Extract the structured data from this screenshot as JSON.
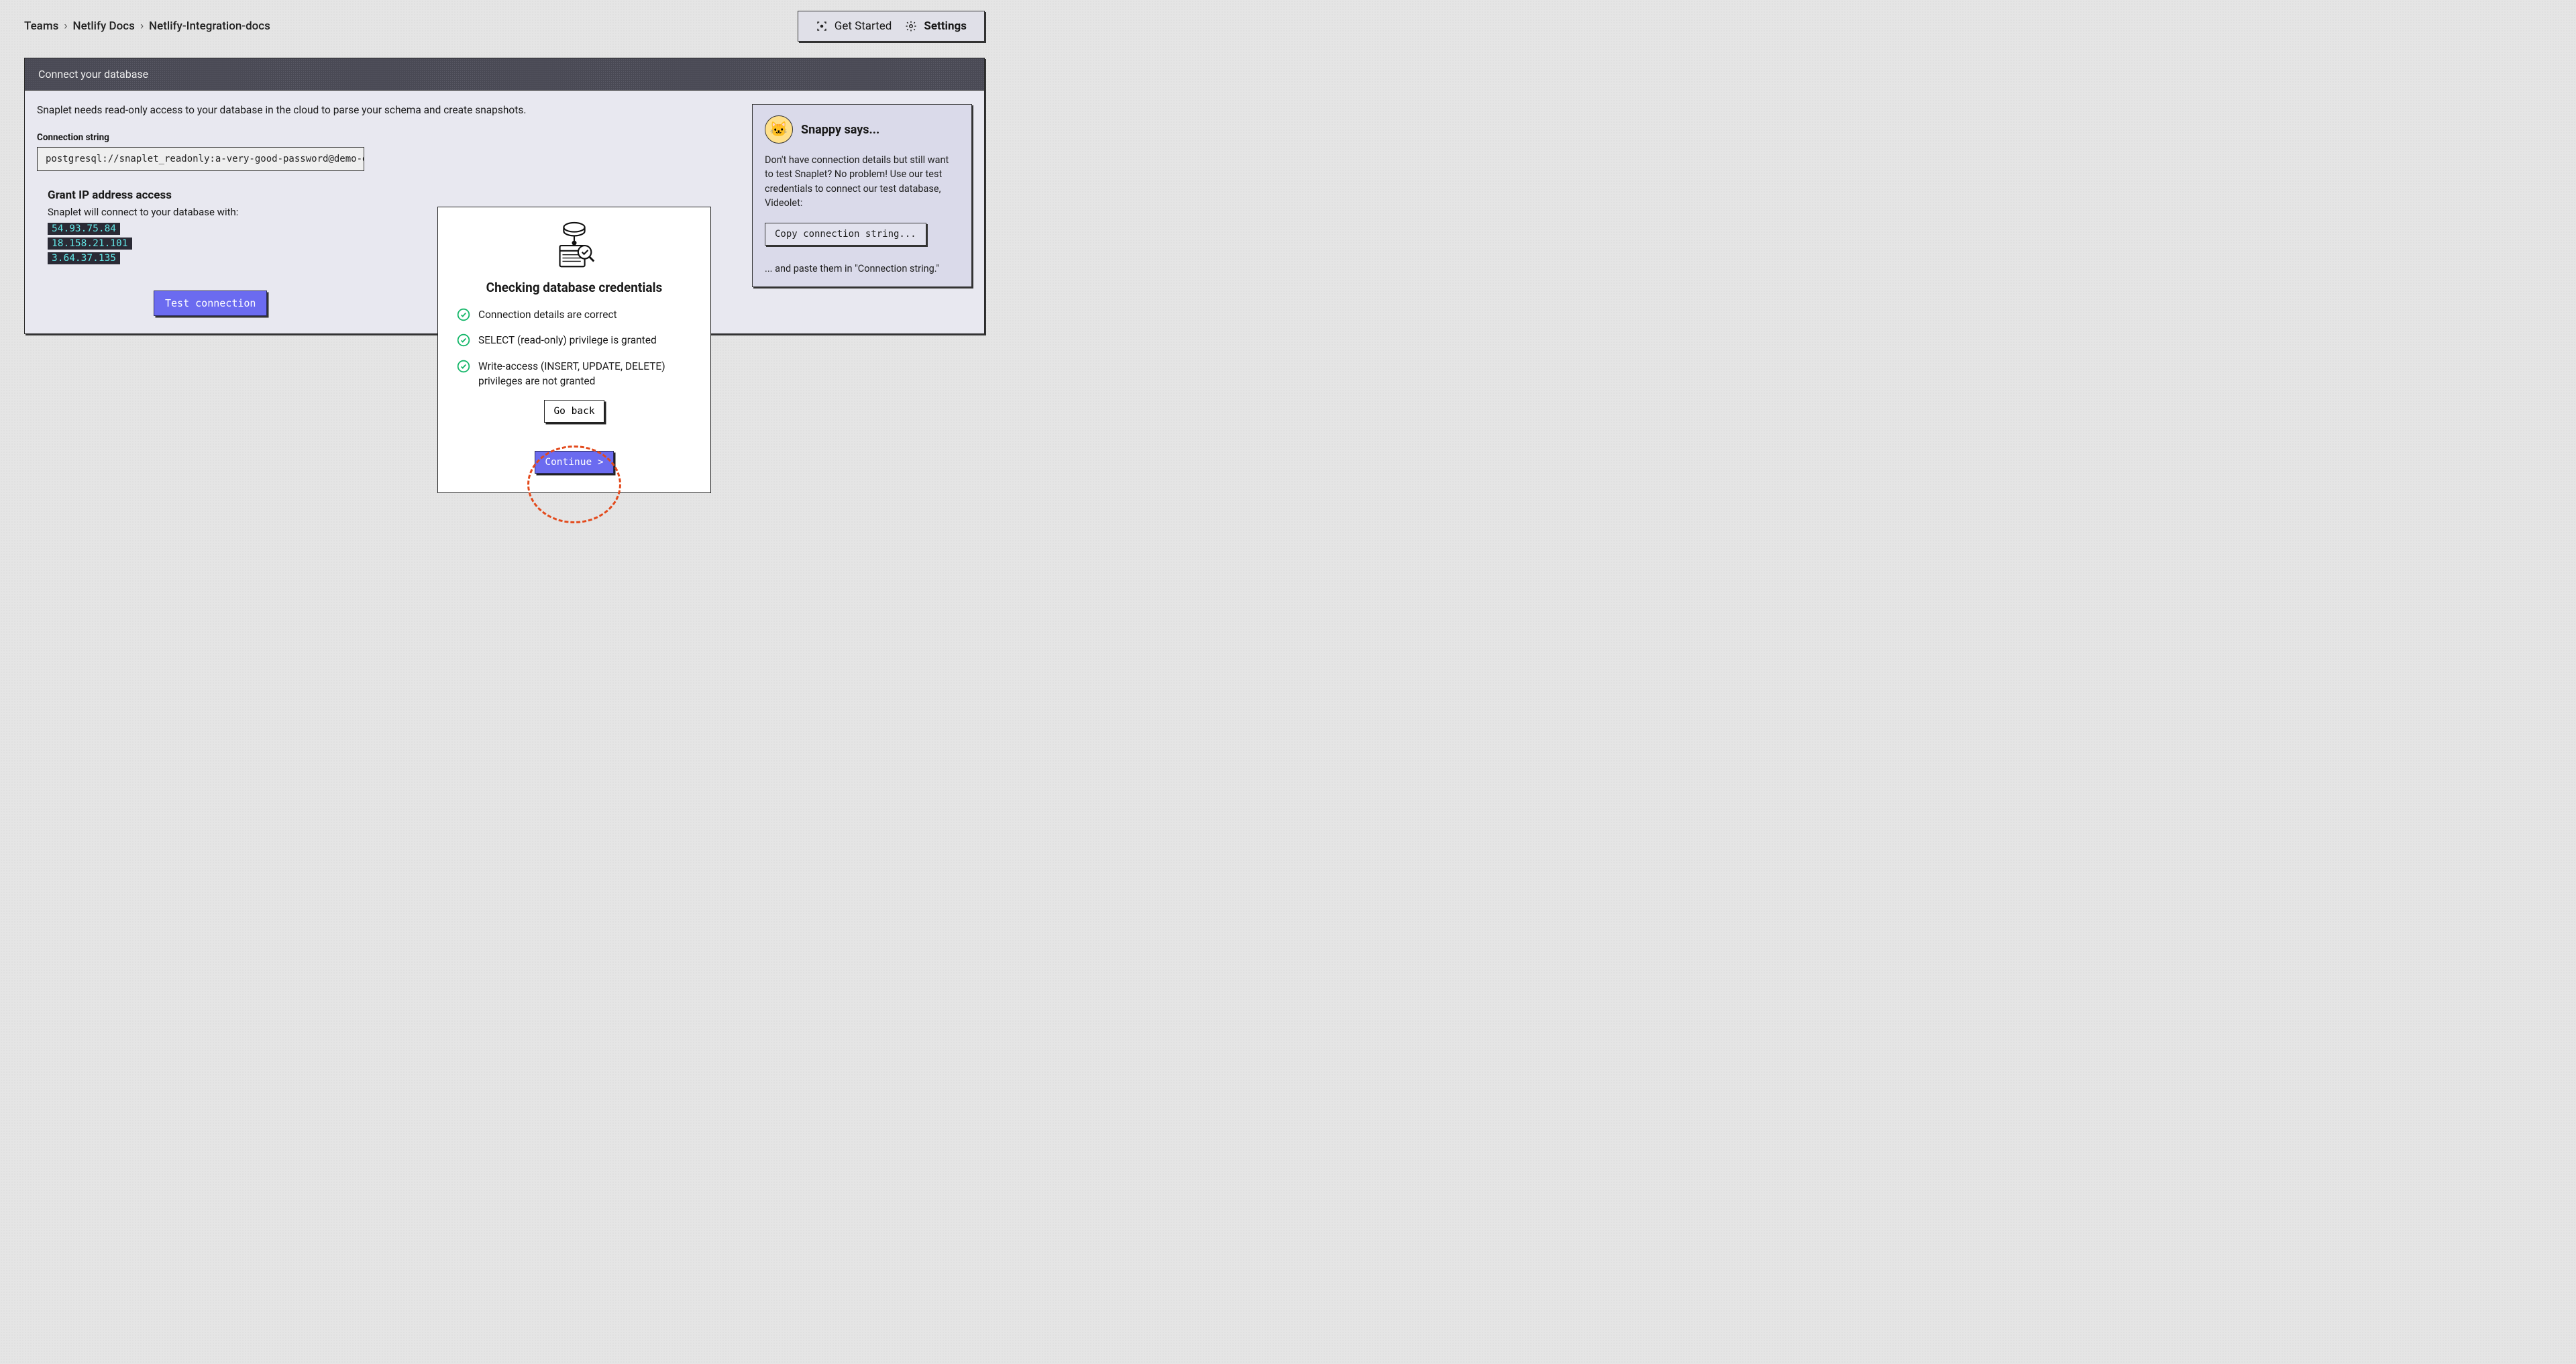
{
  "breadcrumbs": {
    "items": [
      "Teams",
      "Netlify Docs",
      "Netlify-Integration-docs"
    ]
  },
  "topbar": {
    "get_started": "Get Started",
    "settings": "Settings"
  },
  "panel": {
    "title": "Connect your database",
    "description": "Snaplet needs read-only access to your database in the cloud to parse your schema and create snapshots.",
    "conn_label": "Connection string",
    "conn_value": "postgresql://snaplet_readonly:a-very-good-password@demo-d",
    "grant_title": "Grant IP address access",
    "grant_desc": "Snaplet will connect to your database with:",
    "ips": [
      "54.93.75.84",
      "18.158.21.101",
      "3.64.37.135"
    ],
    "test_button": "Test connection"
  },
  "snappy": {
    "title": "Snappy says...",
    "text": "Don't have connection details but still want to test Snaplet? No problem! Use our test credentials to connect our test database, Videolet:",
    "copy_button": "Copy connection string...",
    "footer": "... and paste them in \"Connection string.\""
  },
  "modal": {
    "title": "Checking database credentials",
    "checks": [
      "Connection details are correct",
      "SELECT (read-only) privilege is granted",
      "Write-access (INSERT, UPDATE, DELETE) privileges are not granted"
    ],
    "go_back": "Go back",
    "continue": "Continue >"
  }
}
